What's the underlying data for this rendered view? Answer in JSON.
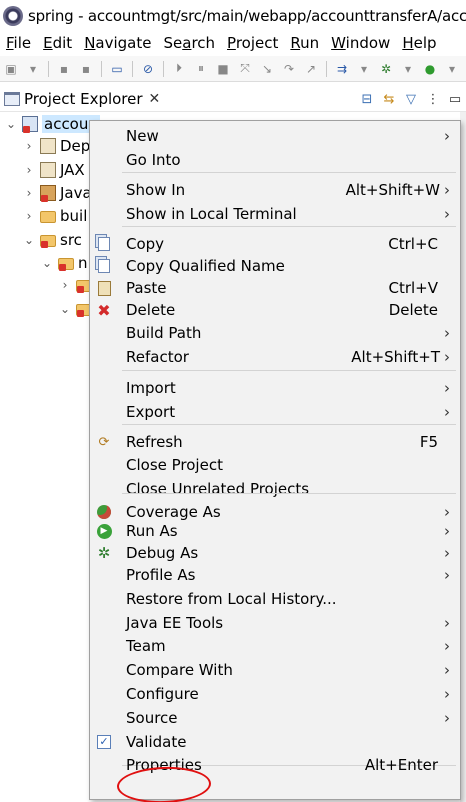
{
  "window": {
    "title": "spring - accountmgt/src/main/webapp/accounttransferA/accoun"
  },
  "menubar": [
    {
      "label": "File",
      "mnemonic": "F",
      "rest": "ile"
    },
    {
      "label": "Edit",
      "mnemonic": "E",
      "rest": "dit"
    },
    {
      "label": "Navigate",
      "mnemonic": "N",
      "rest": "avigate"
    },
    {
      "label": "Search",
      "mnemonic": "a",
      "pre": "Se",
      "rest": "rch"
    },
    {
      "label": "Project",
      "mnemonic": "P",
      "rest": "roject"
    },
    {
      "label": "Run",
      "mnemonic": "R",
      "rest": "un"
    },
    {
      "label": "Window",
      "mnemonic": "W",
      "rest": "indow"
    },
    {
      "label": "Help",
      "mnemonic": "H",
      "rest": "elp"
    }
  ],
  "explorer": {
    "tab_label": "Project Explorer",
    "close_glyph": "✕"
  },
  "tree": [
    {
      "label": "accoun",
      "level": 0,
      "twisty": "⌄",
      "icon": "proj",
      "error": true,
      "selected": true
    },
    {
      "label": "Dep",
      "level": 1,
      "twisty": "›",
      "icon": "lib",
      "error": false
    },
    {
      "label": "JAX",
      "level": 1,
      "twisty": "›",
      "icon": "lib",
      "error": false
    },
    {
      "label": "Java",
      "level": 1,
      "twisty": "›",
      "icon": "jar",
      "error": true
    },
    {
      "label": "buil",
      "level": 1,
      "twisty": "›",
      "icon": "folder",
      "error": false
    },
    {
      "label": "src",
      "level": 1,
      "twisty": "⌄",
      "icon": "folder",
      "error": true
    },
    {
      "label": "n",
      "level": 2,
      "twisty": "⌄",
      "icon": "folder",
      "error": true
    },
    {
      "label": "",
      "level": 3,
      "twisty": "›",
      "icon": "folder",
      "error": true
    },
    {
      "label": "",
      "level": 3,
      "twisty": "⌄",
      "icon": "folder",
      "error": true
    }
  ],
  "context_menu": {
    "items": [
      {
        "label": "New",
        "shortcut": "",
        "submenu": true,
        "icon": ""
      },
      {
        "label": "Go Into",
        "shortcut": "",
        "submenu": false,
        "icon": ""
      },
      {
        "sep": true
      },
      {
        "label": "Show In",
        "shortcut": "Alt+Shift+W",
        "submenu": true,
        "icon": ""
      },
      {
        "label": "Show in Local Terminal",
        "shortcut": "",
        "submenu": true,
        "icon": ""
      },
      {
        "sep": true
      },
      {
        "label": "Copy",
        "shortcut": "Ctrl+C",
        "submenu": false,
        "icon": "copy"
      },
      {
        "label": "Copy Qualified Name",
        "shortcut": "",
        "submenu": false,
        "icon": "copy"
      },
      {
        "label": "Paste",
        "shortcut": "Ctrl+V",
        "submenu": false,
        "icon": "paste"
      },
      {
        "label": "Delete",
        "shortcut": "Delete",
        "submenu": false,
        "icon": "delete"
      },
      {
        "label": "Build Path",
        "shortcut": "",
        "submenu": true,
        "icon": ""
      },
      {
        "label": "Refactor",
        "shortcut": "Alt+Shift+T",
        "submenu": true,
        "icon": ""
      },
      {
        "sep": true
      },
      {
        "label": "Import",
        "shortcut": "",
        "submenu": true,
        "icon": ""
      },
      {
        "label": "Export",
        "shortcut": "",
        "submenu": true,
        "icon": ""
      },
      {
        "sep": true
      },
      {
        "label": "Refresh",
        "shortcut": "F5",
        "submenu": false,
        "icon": "refresh"
      },
      {
        "label": "Close Project",
        "shortcut": "",
        "submenu": false,
        "icon": ""
      },
      {
        "label": "Close Unrelated Projects",
        "shortcut": "",
        "submenu": false,
        "icon": ""
      },
      {
        "sep": true
      },
      {
        "label": "Coverage As",
        "shortcut": "",
        "submenu": true,
        "icon": "coverage"
      },
      {
        "label": "Run As",
        "shortcut": "",
        "submenu": true,
        "icon": "run"
      },
      {
        "label": "Debug As",
        "shortcut": "",
        "submenu": true,
        "icon": "debug"
      },
      {
        "label": "Profile As",
        "shortcut": "",
        "submenu": true,
        "icon": ""
      },
      {
        "label": "Restore from Local History...",
        "shortcut": "",
        "submenu": false,
        "icon": ""
      },
      {
        "label": "Java EE Tools",
        "shortcut": "",
        "submenu": true,
        "icon": ""
      },
      {
        "label": "Team",
        "shortcut": "",
        "submenu": true,
        "icon": ""
      },
      {
        "label": "Compare With",
        "shortcut": "",
        "submenu": true,
        "icon": ""
      },
      {
        "label": "Configure",
        "shortcut": "",
        "submenu": true,
        "icon": ""
      },
      {
        "label": "Source",
        "shortcut": "",
        "submenu": true,
        "icon": ""
      },
      {
        "label": "Validate",
        "shortcut": "",
        "submenu": false,
        "icon": "validate"
      },
      {
        "sep": true
      },
      {
        "label": "Properties",
        "shortcut": "Alt+Enter",
        "submenu": false,
        "icon": "",
        "highlighted": true
      }
    ],
    "submenu_glyph": "›"
  },
  "colors": {
    "menu_bg": "#f2f2f2",
    "selection": "#cde8ff",
    "annotation_red": "#e01010"
  }
}
